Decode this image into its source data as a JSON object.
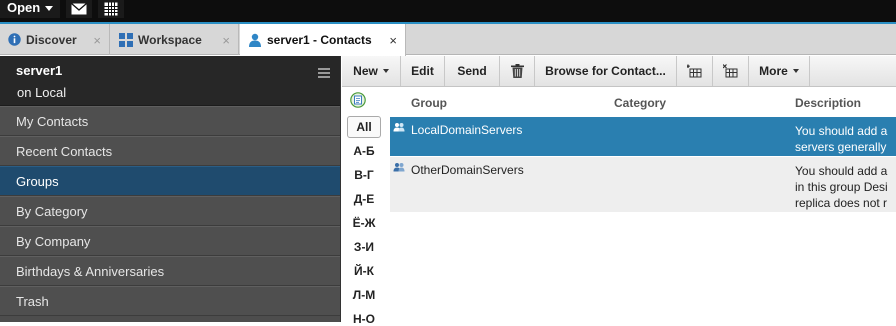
{
  "topbar": {
    "open_label": "Open",
    "icons": [
      "mail-icon",
      "calendar-icon"
    ]
  },
  "tabs": [
    {
      "label": "Discover",
      "icon": "info-icon",
      "close": "×"
    },
    {
      "label": "Workspace",
      "icon": "workspace-grid-icon",
      "close": "×"
    },
    {
      "label": "server1 - Contacts",
      "icon": "person-icon",
      "close": "×",
      "active": true
    }
  ],
  "sidebar": {
    "title": "server1",
    "subtitle": "on Local",
    "items": [
      {
        "label": "My Contacts"
      },
      {
        "label": "Recent Contacts"
      },
      {
        "label": "Groups",
        "selected": true
      },
      {
        "label": "By Category"
      },
      {
        "label": "By Company"
      },
      {
        "label": "Birthdays & Anniversaries"
      },
      {
        "label": "Trash"
      }
    ]
  },
  "toolbar": {
    "new_label": "New",
    "edit_label": "Edit",
    "send_label": "Send",
    "browse_label": "Browse for Contact...",
    "more_label": "More"
  },
  "alphabet": {
    "all_label": "All",
    "letters": [
      "А-Б",
      "В-Г",
      "Д-Е",
      "Ё-Ж",
      "З-И",
      "Й-К",
      "Л-М",
      "Н-О"
    ]
  },
  "columns": {
    "group": "Group",
    "category": "Category",
    "description": "Description"
  },
  "rows": [
    {
      "group": "LocalDomainServers",
      "category": "",
      "desc_lines": [
        "You should add a",
        "servers generally"
      ]
    },
    {
      "group": "OtherDomainServers",
      "category": "",
      "desc_lines": [
        "You should add a",
        "in this group Desi",
        "replica does not r"
      ]
    }
  ],
  "colors": {
    "accent": "#2a8fc4",
    "selection": "#2a7fb0",
    "sidebar_selected": "#1f4b6e",
    "sidebar_bg": "#4f4f4f"
  }
}
